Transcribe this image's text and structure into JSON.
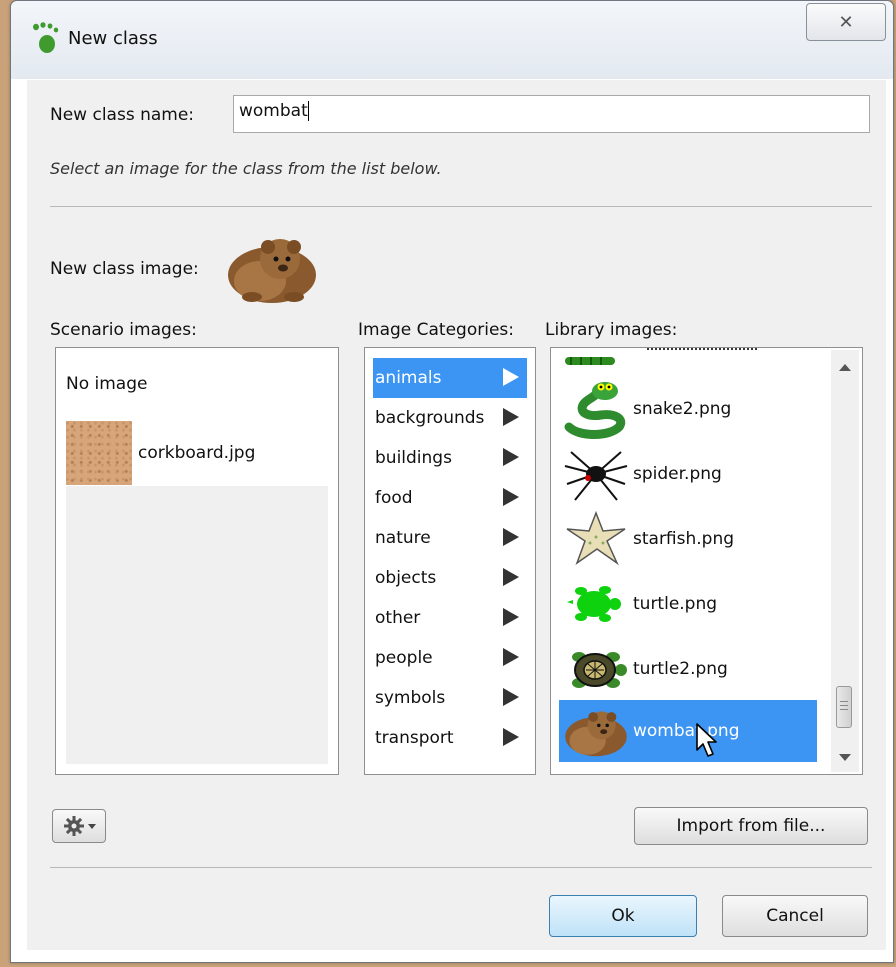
{
  "window": {
    "title": "New class",
    "close_label": "✕"
  },
  "form": {
    "name_label": "New class name:",
    "name_value": "wombat",
    "hint": "Select an image for the class from the list below.",
    "class_image_label": "New class image:"
  },
  "scenario": {
    "label": "Scenario images:",
    "items": [
      {
        "label": "No image",
        "icon": "none"
      },
      {
        "label": "corkboard.jpg",
        "icon": "corkboard-thumbnail"
      }
    ]
  },
  "categories": {
    "label": "Image Categories:",
    "items": [
      "animals",
      "backgrounds",
      "buildings",
      "food",
      "nature",
      "objects",
      "other",
      "people",
      "symbols",
      "transport"
    ],
    "selected": "animals"
  },
  "library": {
    "label": "Library images:",
    "items": [
      {
        "label": "snake2.png",
        "icon": "snake-icon"
      },
      {
        "label": "spider.png",
        "icon": "spider-icon"
      },
      {
        "label": "starfish.png",
        "icon": "starfish-icon"
      },
      {
        "label": "turtle.png",
        "icon": "turtle-icon"
      },
      {
        "label": "turtle2.png",
        "icon": "turtle2-icon"
      },
      {
        "label": "wombat.png",
        "icon": "wombat-icon"
      }
    ],
    "selected": "wombat.png"
  },
  "buttons": {
    "import": "Import from file...",
    "ok": "Ok",
    "cancel": "Cancel"
  },
  "colors": {
    "selection": "#3c95f3",
    "dialog_bg": "#f0f0f0"
  }
}
